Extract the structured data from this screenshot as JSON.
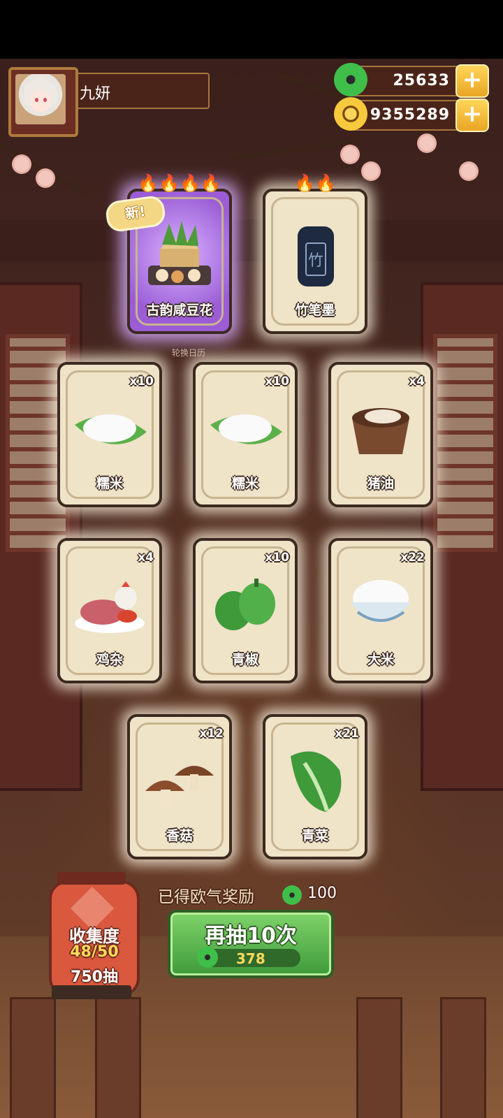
{
  "player": {
    "name": "九妍"
  },
  "currency": {
    "jade": {
      "value": "25633",
      "icon": "jade-icon",
      "add_icon": "plus-icon"
    },
    "coin": {
      "value": "9355289",
      "icon": "coin-icon",
      "add_icon": "plus-icon"
    }
  },
  "featured": [
    {
      "label": "古韵咸豆花",
      "flames": "🔥🔥🔥🔥",
      "new_badge": "新!",
      "highlight": "purple"
    },
    {
      "label": "竹笔墨",
      "flames": "🔥🔥"
    }
  ],
  "background_sign": "轮换日历",
  "items": [
    {
      "label": "糯米",
      "qty": "x10"
    },
    {
      "label": "糯米",
      "qty": "x10"
    },
    {
      "label": "猪油",
      "qty": "x4"
    },
    {
      "label": "鸡杂",
      "qty": "x4"
    },
    {
      "label": "青椒",
      "qty": "x10"
    },
    {
      "label": "大米",
      "qty": "x22"
    },
    {
      "label": "香菇",
      "qty": "x12"
    },
    {
      "label": "青菜",
      "qty": "x21"
    }
  ],
  "bonus": {
    "label": "已得欧气奖励",
    "value": "100"
  },
  "draw_button": {
    "label": "再抽10次",
    "cost": "378"
  },
  "collection": {
    "title": "收集度",
    "progress": "48/50",
    "draws": "750抽"
  },
  "colors": {
    "jade_green": "#3fbf4a",
    "gold": "#f7c93c",
    "accent_purple": "#9b5cd6",
    "button_green": "#5bb64d"
  }
}
